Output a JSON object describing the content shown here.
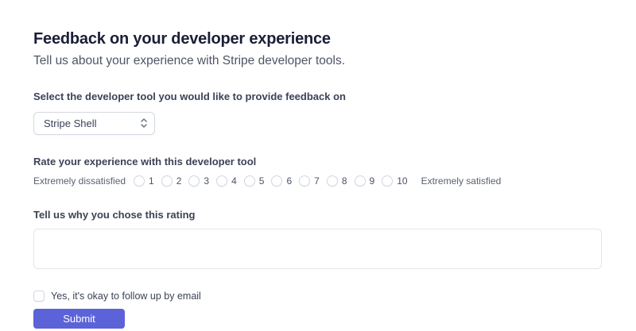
{
  "page": {
    "title": "Feedback on your developer experience",
    "subtitle": "Tell us about your experience with Stripe developer tools."
  },
  "tool_select": {
    "label": "Select the developer tool you would like to provide feedback on",
    "value": "Stripe Shell"
  },
  "rating": {
    "label": "Rate your experience with this developer tool",
    "min_label": "Extremely dissatisfied",
    "max_label": "Extremely satisfied",
    "options": [
      "1",
      "2",
      "3",
      "4",
      "5",
      "6",
      "7",
      "8",
      "9",
      "10"
    ],
    "selected": null
  },
  "reason": {
    "label": "Tell us why you chose this rating",
    "value": ""
  },
  "follow_up": {
    "label": "Yes, it's okay to follow up by email",
    "checked": false
  },
  "submit": {
    "label": "Submit"
  },
  "colors": {
    "accent": "#5c63d8",
    "title_text": "#1a1f36",
    "body_text": "#3c4257",
    "muted_text": "#596171",
    "input_border": "#d5dae1"
  }
}
